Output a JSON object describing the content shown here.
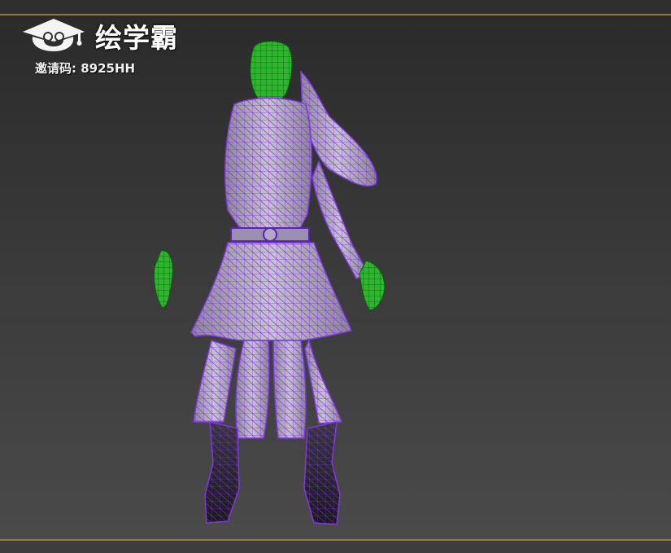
{
  "watermark": {
    "brand": "绘学霸",
    "invite_label": "邀请码: 8925HH",
    "logo_icon": "cloud-mortarboard-icon"
  },
  "viewport": {
    "background_top": "#2a2a2a",
    "background_bottom": "#4b4b4b",
    "frame_border": "#8e7a4e"
  },
  "model": {
    "description_icon": "wireframe-character-icon",
    "mesh_color": "#7c3ad8",
    "body_color": "#b9b0c4",
    "selection_color": "#2db52d"
  }
}
